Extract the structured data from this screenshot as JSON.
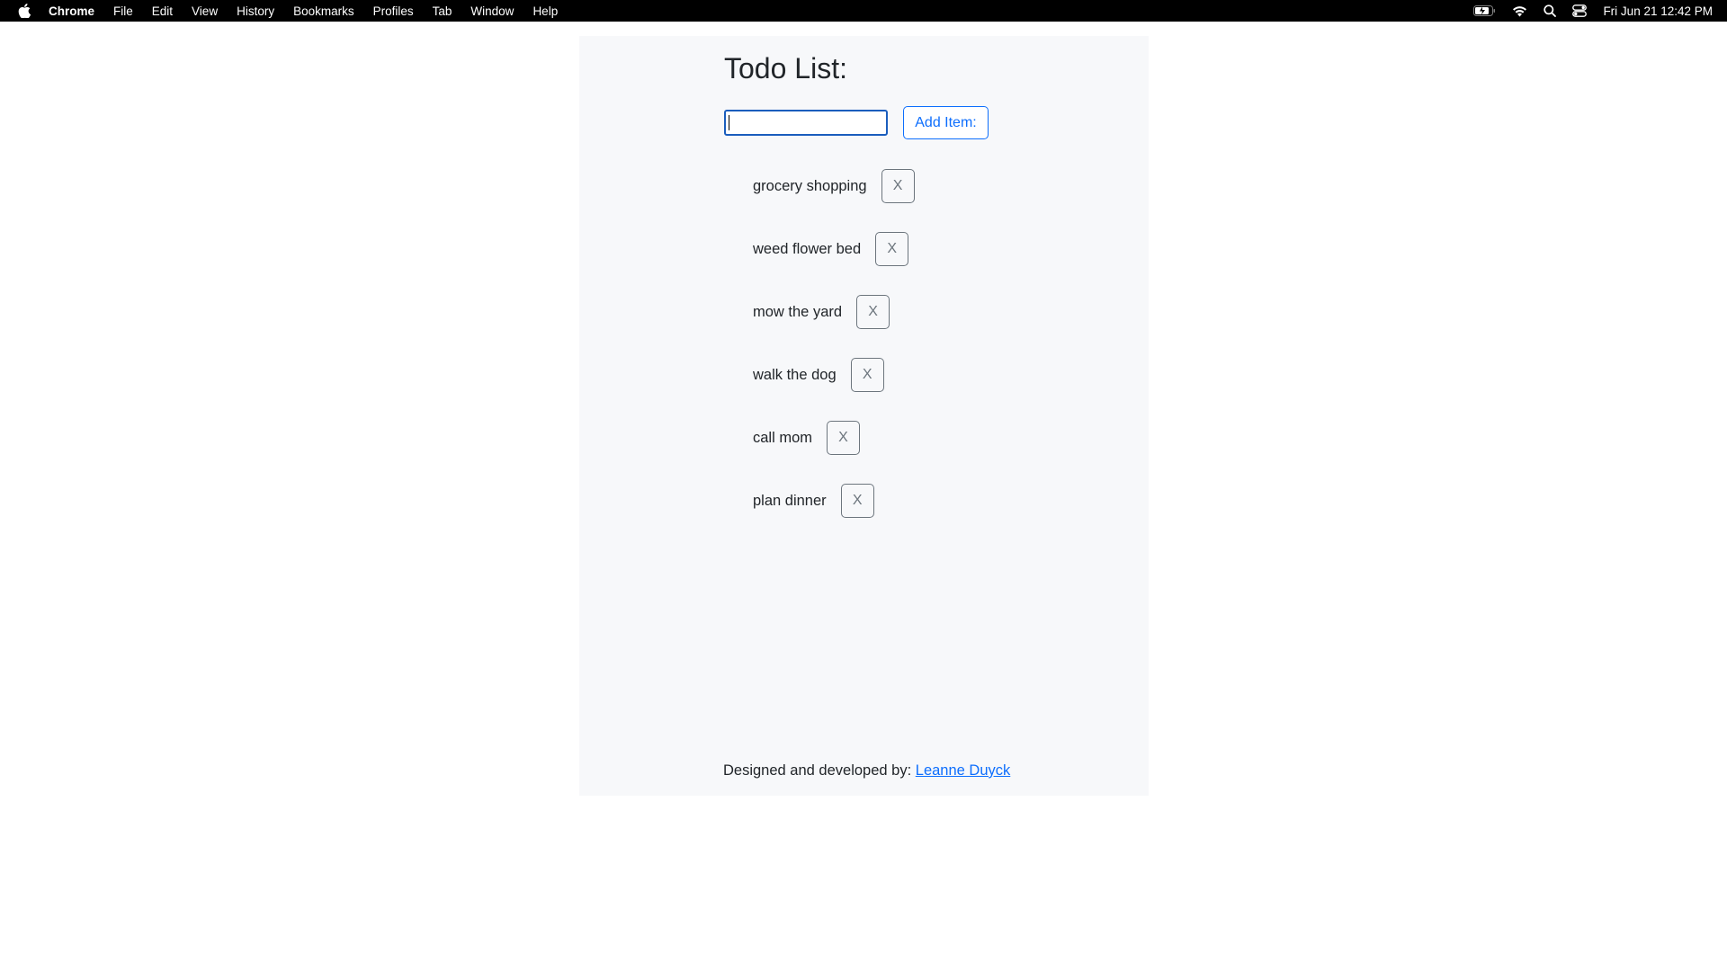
{
  "menubar": {
    "app_name": "Chrome",
    "items": [
      "File",
      "Edit",
      "View",
      "History",
      "Bookmarks",
      "Profiles",
      "Tab",
      "Window",
      "Help"
    ],
    "clock": "Fri Jun 21  12:42 PM",
    "icons": [
      "apple-icon",
      "battery-icon",
      "wifi-icon",
      "search-icon",
      "control-center-icon"
    ]
  },
  "page": {
    "title": "Todo List:",
    "input": {
      "value": "",
      "placeholder": ""
    },
    "add_button": "Add Item:",
    "todos": [
      {
        "text": "grocery shopping",
        "delete_label": "X"
      },
      {
        "text": "weed flower bed",
        "delete_label": "X"
      },
      {
        "text": "mow the yard",
        "delete_label": "X"
      },
      {
        "text": "walk the dog",
        "delete_label": "X"
      },
      {
        "text": "call mom",
        "delete_label": "X"
      },
      {
        "text": "plan dinner",
        "delete_label": "X"
      }
    ],
    "footer": {
      "prefix": "Designed and developed by:",
      "author_link": "Leanne Duyck"
    }
  },
  "colors": {
    "menubar_bg": "#000000",
    "container_bg": "#f7f8fa",
    "accent": "#0d6efd",
    "secondary": "#6c757d",
    "text": "#212529"
  }
}
